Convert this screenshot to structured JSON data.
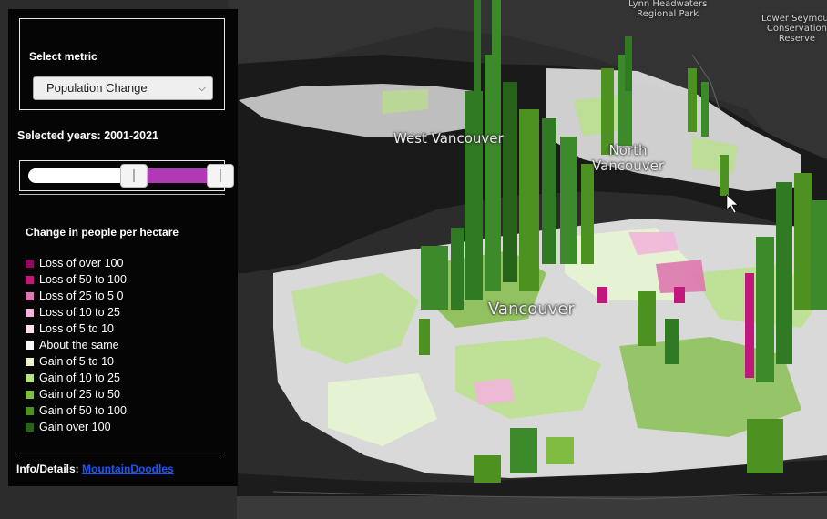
{
  "panel": {
    "metric_title": "Select metric",
    "metric_selected": "Population Change",
    "years_label": "Selected years: 2001-2021",
    "slider": {
      "range_start_fraction": 0.52,
      "range_end_fraction": 0.94,
      "range_color": "#b03ab6"
    },
    "legend_title": "Change in people per hectare",
    "legend": [
      {
        "label": "Loss of over 100",
        "color": "#8e0a5f"
      },
      {
        "label": "Loss of 50 to 100",
        "color": "#c2177d"
      },
      {
        "label": "Loss of 25 to 5 0",
        "color": "#de77ae"
      },
      {
        "label": "Loss of 10 to 25",
        "color": "#f1b6da"
      },
      {
        "label": "Loss of 5 to 10",
        "color": "#fde0ef"
      },
      {
        "label": "About the same",
        "color": "#f7f7f7"
      },
      {
        "label": "Gain of 5 to 10",
        "color": "#e6f5d0"
      },
      {
        "label": "Gain of 10 to 25",
        "color": "#b8e186"
      },
      {
        "label": "Gain of 25 to 50",
        "color": "#7fbc41"
      },
      {
        "label": "Gain of 50 to 100",
        "color": "#4d9221"
      },
      {
        "label": "Gain over 100",
        "color": "#276419"
      }
    ],
    "info_label": "Info/Details:",
    "info_link": "MountainDoodles"
  },
  "map": {
    "labels": {
      "lynn_headwaters": "Lynn Headwaters\nRegional Park",
      "lower_seymour": "Lower Seymour\nConservation\nReserve",
      "west_vancouver": "West Vancouver",
      "north_vancouver": "North\nVancouver",
      "vancouver": "Vancouver"
    }
  }
}
